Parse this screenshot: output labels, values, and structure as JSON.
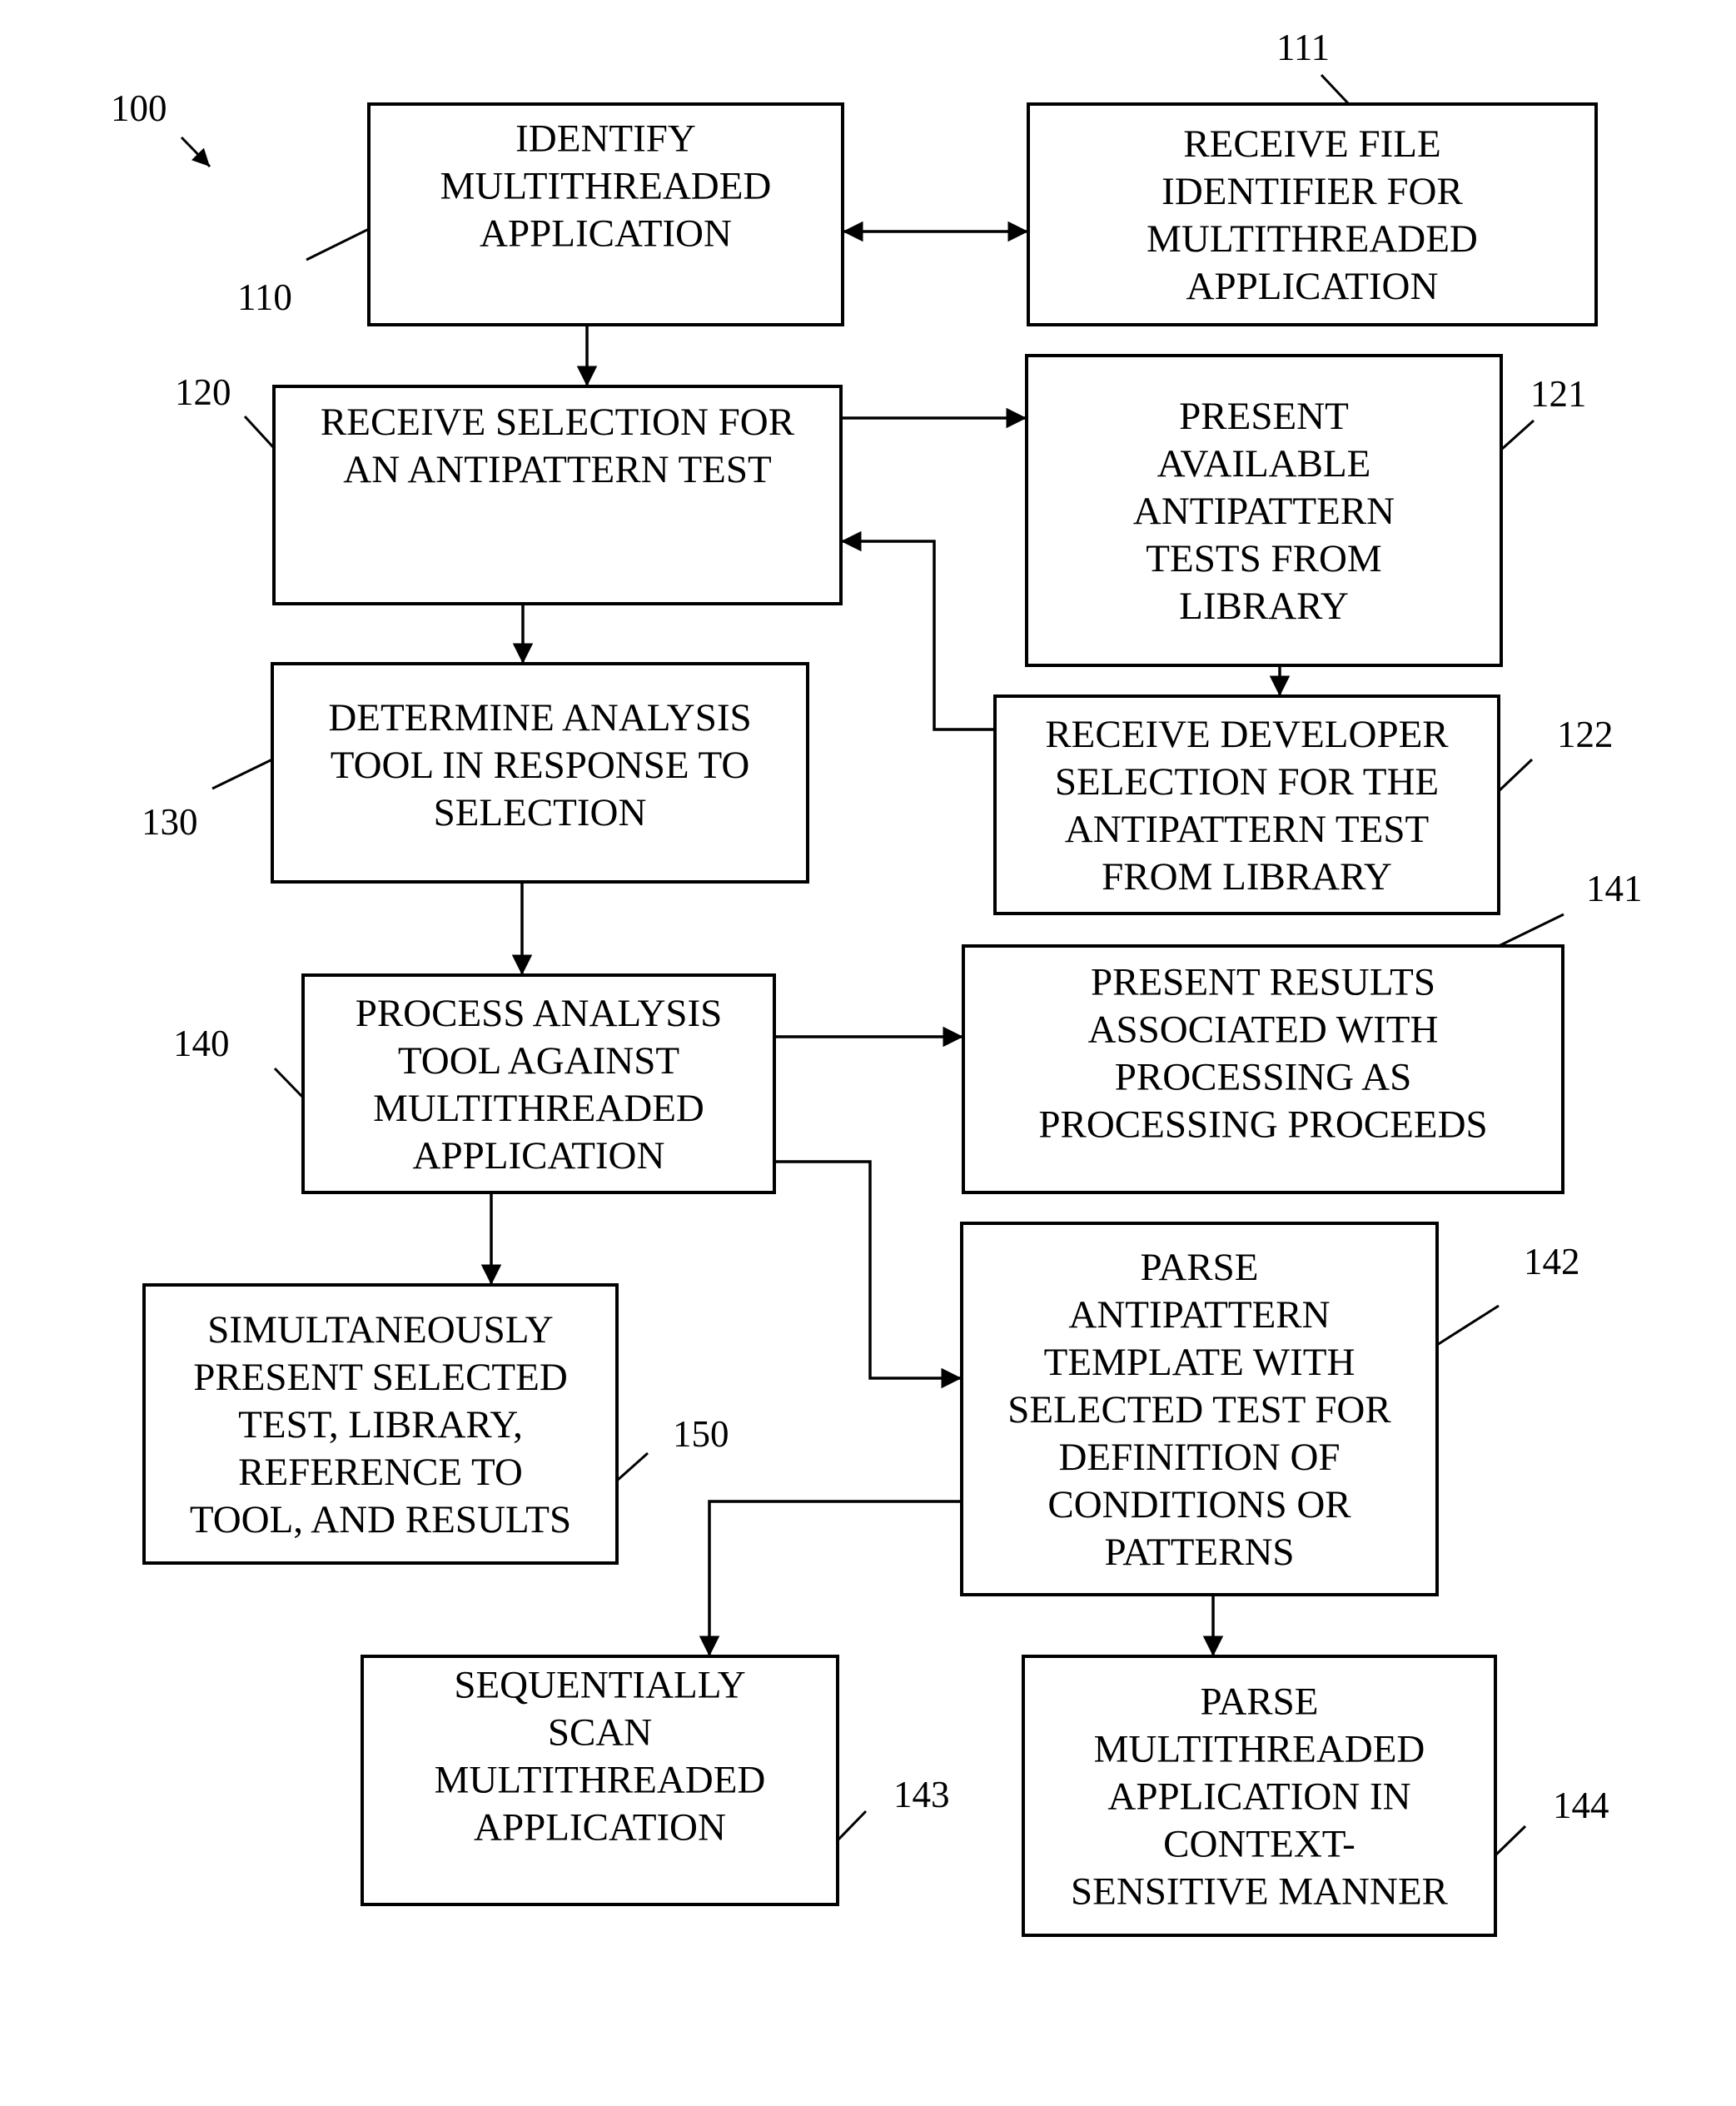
{
  "figure": {
    "reference": "100",
    "boxes": {
      "b110": {
        "ref": "110",
        "lines": [
          "IDENTIFY",
          "MULTITHREADED",
          "APPLICATION"
        ]
      },
      "b111": {
        "ref": "111",
        "lines": [
          "RECEIVE FILE",
          "IDENTIFIER FOR",
          "MULTITHREADED",
          "APPLICATION"
        ]
      },
      "b120": {
        "ref": "120",
        "lines": [
          "RECEIVE SELECTION FOR",
          "AN ANTIPATTERN TEST"
        ]
      },
      "b121": {
        "ref": "121",
        "lines": [
          "PRESENT",
          "AVAILABLE",
          "ANTIPATTERN",
          "TESTS FROM",
          "LIBRARY"
        ]
      },
      "b122": {
        "ref": "122",
        "lines": [
          "RECEIVE DEVELOPER",
          "SELECTION FOR THE",
          "ANTIPATTERN TEST",
          "FROM LIBRARY"
        ]
      },
      "b130": {
        "ref": "130",
        "lines": [
          "DETERMINE ANALYSIS",
          "TOOL IN RESPONSE TO",
          "SELECTION"
        ]
      },
      "b140": {
        "ref": "140",
        "lines": [
          "PROCESS ANALYSIS",
          "TOOL AGAINST",
          "MULTITHREADED",
          "APPLICATION"
        ]
      },
      "b141": {
        "ref": "141",
        "lines": [
          "PRESENT RESULTS",
          "ASSOCIATED WITH",
          "PROCESSING AS",
          "PROCESSING PROCEEDS"
        ]
      },
      "b142": {
        "ref": "142",
        "lines": [
          "PARSE",
          "ANTIPATTERN",
          "TEMPLATE WITH",
          "SELECTED TEST FOR",
          "DEFINITION OF",
          "CONDITIONS OR",
          "PATTERNS"
        ]
      },
      "b150": {
        "ref": "150",
        "lines": [
          "SIMULTANEOUSLY",
          "PRESENT SELECTED",
          "TEST, LIBRARY,",
          "REFERENCE TO",
          "TOOL, AND RESULTS"
        ]
      },
      "b143": {
        "ref": "143",
        "lines": [
          "SEQUENTIALLY",
          "SCAN",
          "MULTITHREADED",
          "APPLICATION"
        ]
      },
      "b144": {
        "ref": "144",
        "lines": [
          "PARSE",
          "MULTITHREADED",
          "APPLICATION IN",
          "CONTEXT-",
          "SENSITIVE MANNER"
        ]
      }
    },
    "edges": [
      {
        "from": "110",
        "to": "111",
        "type": "bidirectional"
      },
      {
        "from": "110",
        "to": "120"
      },
      {
        "from": "120",
        "to": "121"
      },
      {
        "from": "121",
        "to": "122"
      },
      {
        "from": "122",
        "to": "120"
      },
      {
        "from": "120",
        "to": "130"
      },
      {
        "from": "130",
        "to": "140"
      },
      {
        "from": "140",
        "to": "141"
      },
      {
        "from": "140",
        "to": "142"
      },
      {
        "from": "140",
        "to": "150"
      },
      {
        "from": "142",
        "to": "143"
      },
      {
        "from": "142",
        "to": "144"
      }
    ]
  }
}
